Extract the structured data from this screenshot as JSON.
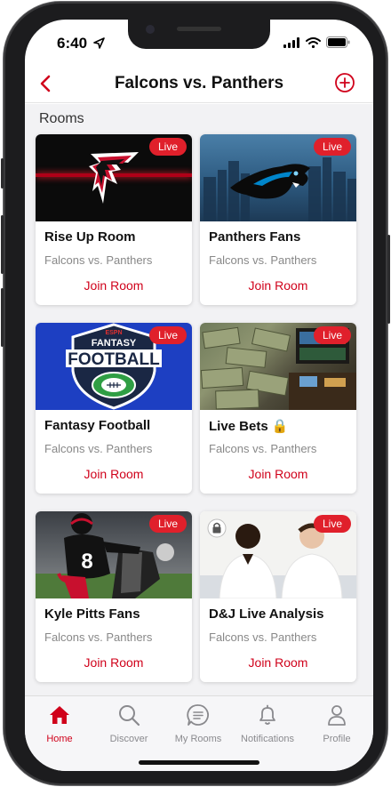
{
  "status_bar": {
    "time": "6:40"
  },
  "header": {
    "title": "Falcons vs. Panthers"
  },
  "section_title": "Rooms",
  "colors": {
    "accent": "#d0021b",
    "live_badge": "#e0202b"
  },
  "rooms": [
    {
      "title": "Rise Up Room",
      "subtitle": "Falcons vs. Panthers",
      "badge": "Live",
      "action": "Join Room",
      "image": "falcons-logo"
    },
    {
      "title": "Panthers Fans",
      "subtitle": "Falcons vs. Panthers",
      "badge": "Live",
      "action": "Join Room",
      "image": "panthers-logo-skyline"
    },
    {
      "title": "Fantasy Football",
      "subtitle": "Falcons vs. Panthers",
      "badge": "Live",
      "action": "Join Room",
      "image": "espn-fantasy-football-logo",
      "image_text": {
        "brand": "ESPN",
        "line1": "FANTASY",
        "line2": "FOOTBALL"
      }
    },
    {
      "title": "Live Bets 🔒",
      "subtitle": "Falcons vs. Panthers",
      "badge": "Live",
      "action": "Join Room",
      "image": "money-stacks"
    },
    {
      "title": "Kyle Pitts Fans",
      "subtitle": "Falcons vs. Panthers",
      "badge": "Live",
      "action": "Join Room",
      "image": "football-player",
      "image_text": {
        "jersey": "8"
      }
    },
    {
      "title": "D&J Live Analysis",
      "subtitle": "Falcons vs. Panthers",
      "badge": "Live",
      "action": "Join Room",
      "image": "two-hosts",
      "locked": true
    }
  ],
  "tabs": [
    {
      "label": "Home",
      "icon": "home-icon",
      "active": true
    },
    {
      "label": "Discover",
      "icon": "search-icon"
    },
    {
      "label": "My Rooms",
      "icon": "chat-icon"
    },
    {
      "label": "Notifications",
      "icon": "bell-icon"
    },
    {
      "label": "Profile",
      "icon": "person-icon"
    }
  ]
}
